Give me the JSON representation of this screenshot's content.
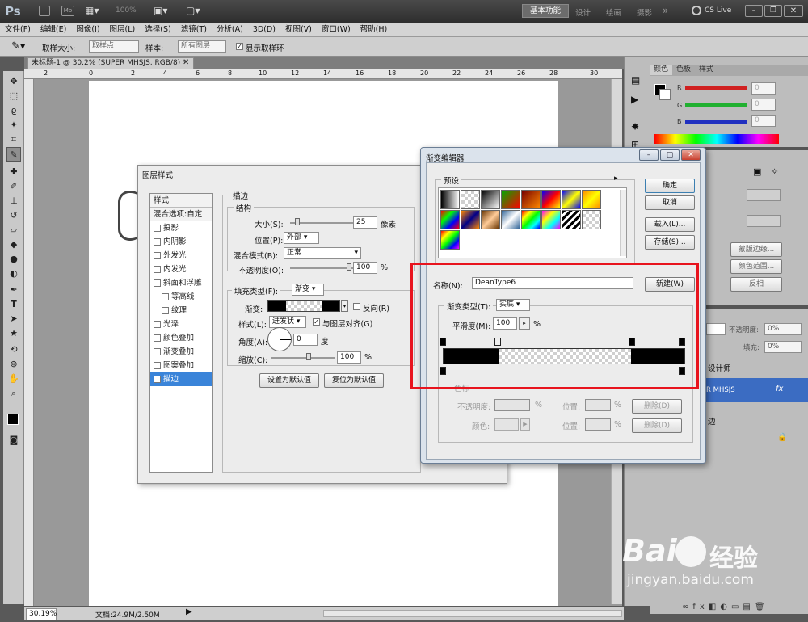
{
  "app": {
    "logo": "Ps",
    "zoom": "100%",
    "workspaces": [
      "基本功能",
      "设计",
      "绘画",
      "摄影"
    ],
    "more": "»",
    "cslive": "CS Live"
  },
  "menu": [
    "文件(F)",
    "编辑(E)",
    "图像(I)",
    "图层(L)",
    "选择(S)",
    "滤镜(T)",
    "分析(A)",
    "3D(D)",
    "视图(V)",
    "窗口(W)",
    "帮助(H)"
  ],
  "options": {
    "sample_size_label": "取样大小:",
    "sample_size_value": "取样点",
    "sample_label": "样本:",
    "sample_value": "所有图层",
    "show_ring": "显示取样环"
  },
  "document": {
    "tab_title": "未标题-1 @ 30.2% (SUPER MHSJS, RGB/8) *",
    "ruler_ticks": [
      "2",
      "0",
      "2",
      "4",
      "6",
      "8",
      "10",
      "12",
      "14",
      "16",
      "18",
      "20",
      "22",
      "24",
      "26",
      "28",
      "30"
    ]
  },
  "status": {
    "zoom": "30.19%",
    "doc": "文档:24.9M/2.50M"
  },
  "color_panel": {
    "tabs": [
      "颜色",
      "色板",
      "样式"
    ],
    "channels": [
      {
        "label": "R",
        "value": "0",
        "color": "#e02020"
      },
      {
        "label": "G",
        "value": "0",
        "color": "#20c020"
      },
      {
        "label": "B",
        "value": "0",
        "color": "#2030d0"
      }
    ]
  },
  "adjust_panel": {
    "refine_edge": "蒙版边缘...",
    "color_range": "颜色范围...",
    "invert": "反相"
  },
  "layers_panel": {
    "opacity_label": "不透明度:",
    "opacity_value": "0%",
    "fill_label": "填充:",
    "fill_value": "0%",
    "layer1": "设计师",
    "layer2": "R MHSJS",
    "fx": "fx",
    "layer3": "边"
  },
  "layer_style": {
    "title": "图层样式",
    "list_header": "样式",
    "blend_options": "混合选项:自定",
    "items": [
      {
        "label": "投影",
        "checked": false
      },
      {
        "label": "内阴影",
        "checked": false
      },
      {
        "label": "外发光",
        "checked": false
      },
      {
        "label": "内发光",
        "checked": false
      },
      {
        "label": "斜面和浮雕",
        "checked": false
      },
      {
        "label": "等高线",
        "checked": false,
        "sub": true
      },
      {
        "label": "纹理",
        "checked": false,
        "sub": true
      },
      {
        "label": "光泽",
        "checked": false
      },
      {
        "label": "颜色叠加",
        "checked": false
      },
      {
        "label": "渐变叠加",
        "checked": false
      },
      {
        "label": "图案叠加",
        "checked": false
      },
      {
        "label": "描边",
        "checked": true,
        "selected": true
      }
    ],
    "stroke": {
      "group": "描边",
      "structure": "结构",
      "size_label": "大小(S):",
      "size_value": "25",
      "size_unit": "像素",
      "position_label": "位置(P):",
      "position_value": "外部",
      "blend_label": "混合模式(B):",
      "blend_value": "正常",
      "opacity_label": "不透明度(O):",
      "opacity_value": "100",
      "opacity_unit": "%",
      "filltype_label": "填充类型(F):",
      "filltype_value": "渐变",
      "gradient_label": "渐变:",
      "reverse_label": "反向(R)",
      "style_label": "样式(L):",
      "style_value": "迸发状",
      "align_label": "与图层对齐(G)",
      "angle_label": "角度(A):",
      "angle_value": "0",
      "angle_unit": "度",
      "scale_label": "缩放(C):",
      "scale_value": "100",
      "scale_unit": "%",
      "set_default": "设置为默认值",
      "reset_default": "复位为默认值"
    }
  },
  "gradient_editor": {
    "title": "渐变编辑器",
    "presets_label": "预设",
    "ok": "确定",
    "cancel": "取消",
    "load": "载入(L)...",
    "save": "存储(S)...",
    "name_label": "名称(N):",
    "name_value": "DeanType6",
    "new": "新建(W)",
    "type_label": "渐变类型(T):",
    "type_value": "实底",
    "smooth_label": "平滑度(M):",
    "smooth_value": "100",
    "smooth_unit": "%",
    "stops_label": "色标",
    "opacity_label": "不透明度:",
    "location_label": "位置:",
    "delete": "删除(D)",
    "color_label": "颜色:",
    "pct": "%"
  },
  "watermark": {
    "brand": "Bai",
    "brand2": "经验",
    "url": "jingyan.baidu.com"
  }
}
